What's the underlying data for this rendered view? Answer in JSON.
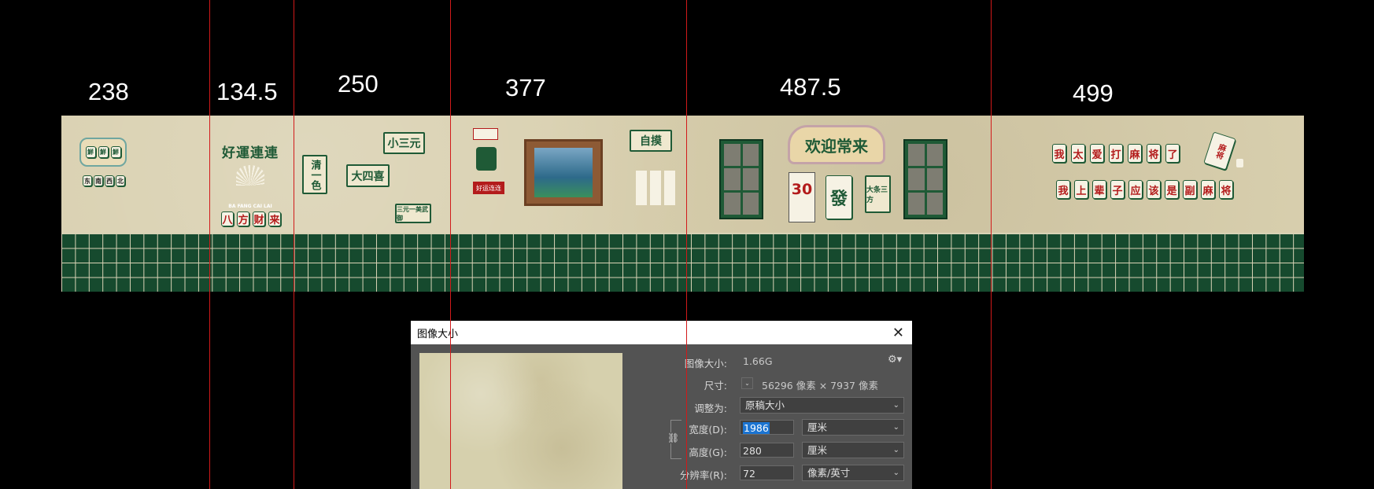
{
  "dimensions": [
    "238",
    "134.5",
    "250",
    "377",
    "487.5",
    "499"
  ],
  "mural": {
    "sec1": {
      "tile_label": "鮮",
      "tiles": [
        "东",
        "南",
        "西",
        "北"
      ]
    },
    "sec2": {
      "title": "好運連連",
      "small_text": "BA FANG CAI LAI",
      "tiles": [
        "八",
        "方",
        "财",
        "来"
      ]
    },
    "sec3": {
      "signs": [
        "小三元",
        "清一色",
        "大四喜",
        "三元一美武御"
      ]
    },
    "sec4": {
      "sign": "自摸",
      "badge": "好运连连"
    },
    "sec5": {
      "banner": "欢迎常来",
      "calendar": "30",
      "fa_tile": "發",
      "side_sign": "大条三方"
    },
    "sec6": {
      "row1": [
        "我",
        "太",
        "爱",
        "打",
        "麻",
        "将",
        "了"
      ],
      "row2": [
        "我",
        "上",
        "辈",
        "子",
        "应",
        "该",
        "是",
        "副",
        "麻",
        "将"
      ],
      "tilted": "麻将"
    }
  },
  "dialog": {
    "title": "图像大小",
    "size_label": "图像大小:",
    "size_value": "1.66G",
    "dims_label": "尺寸:",
    "dims_value": "56296 像素 × 7937 像素",
    "fit_label": "调整为:",
    "fit_value": "原稿大小",
    "width_label": "宽度(D):",
    "width_value": "1986",
    "width_unit": "厘米",
    "height_label": "高度(G):",
    "height_value": "280",
    "height_unit": "厘米",
    "res_label": "分辨率(R):",
    "res_value": "72",
    "res_unit": "像素/英寸"
  }
}
